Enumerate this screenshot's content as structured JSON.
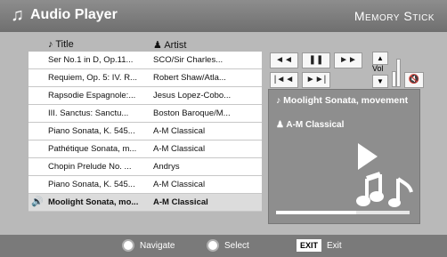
{
  "header": {
    "app_title": "Audio Player",
    "brand": "Memory Stick"
  },
  "playlist": {
    "columns": {
      "title": "Title",
      "artist": "Artist"
    },
    "rows": [
      {
        "title": "Ser No.1 in D, Op.11...",
        "artist": "SCO/Sir Charles..."
      },
      {
        "title": "Requiem, Op. 5: IV. R...",
        "artist": "Robert Shaw/Atla..."
      },
      {
        "title": "Rapsodie Espagnole:...",
        "artist": "Jesus Lopez-Cobo..."
      },
      {
        "title": "III. Sanctus: Sanctu...",
        "artist": "Boston Baroque/M..."
      },
      {
        "title": "Piano Sonata, K. 545...",
        "artist": "A-M Classical"
      },
      {
        "title": "Pathétique Sonata, m...",
        "artist": "A-M Classical"
      },
      {
        "title": "Chopin Prelude No. ...",
        "artist": "Andrys"
      },
      {
        "title": "Piano Sonata, K. 545...",
        "artist": "A-M Classical"
      },
      {
        "title": "Moolight Sonata, mo...",
        "artist": "A-M Classical"
      }
    ],
    "current_index": 8
  },
  "controls": {
    "rew": "◄◄",
    "pause": "❚❚",
    "ff": "►►",
    "prev": "|◄◄",
    "next": "►►|",
    "vol_up": "▲",
    "vol_down": "▼",
    "vol_label": "Vol",
    "mute": "🔇"
  },
  "now_playing": {
    "title": "Moolight Sonata, movement",
    "artist": "A-M Classical",
    "progress_fraction": 0.6
  },
  "footer": {
    "navigate": "Navigate",
    "select": "Select",
    "exit_key": "EXIT",
    "exit": "Exit"
  },
  "icons": {
    "header_note": "music-note-icon",
    "title_col": "note-icon",
    "artist_col": "person-icon",
    "current_row": "speaker-icon"
  },
  "colors": {
    "header_bg": "#7e7e7e",
    "panel_bg": "#8e8e8e",
    "footer_bg": "#7a7a7a",
    "selected_row": "#dcdcdc"
  }
}
